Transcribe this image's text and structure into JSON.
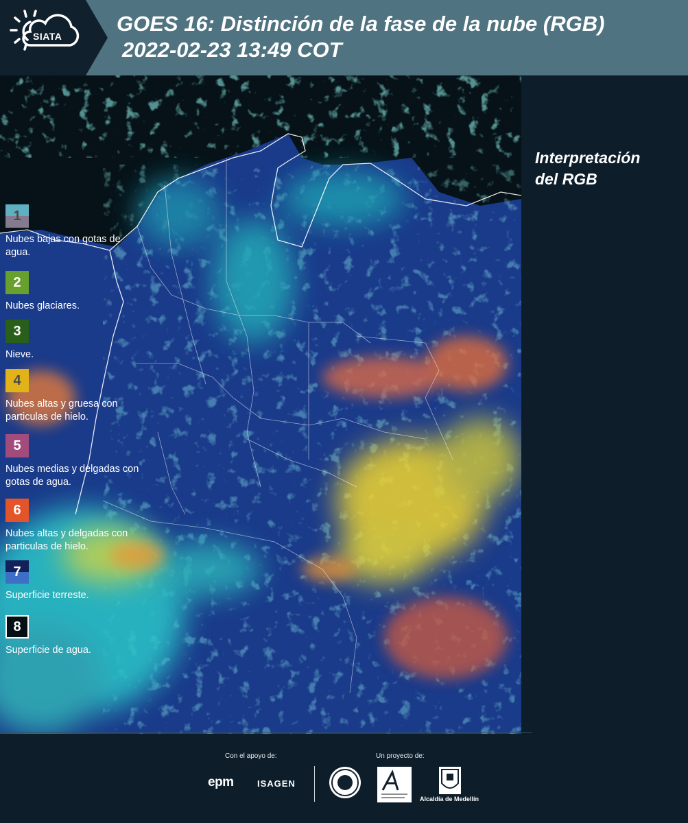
{
  "header": {
    "logo_text": "SIATA",
    "title_line1": "GOES 16: Distinción de la fase de la nube (RGB)",
    "title_line2": "2022-02-23 13:49 COT"
  },
  "legend": {
    "title_line1": "Interpretación",
    "title_line2": "del RGB",
    "items": [
      {
        "number": "1",
        "label": "Nubes bajas con gotas de agua.",
        "color_top": "#5fb0c0",
        "color_bottom": "#857a8e",
        "num_color": "#4a4a4a"
      },
      {
        "number": "2",
        "label": "Nubes glaciares.",
        "color_top": "#67a02c",
        "color_bottom": "#67a02c",
        "num_color": "#ffffff"
      },
      {
        "number": "3",
        "label": "Nieve.",
        "color_top": "#2a5f1b",
        "color_bottom": "#2a5f1b",
        "num_color": "#ffffff"
      },
      {
        "number": "4",
        "label": "Nubes altas y gruesa con particulas de hielo.",
        "color_top": "#e2b319",
        "color_bottom": "#e2b319",
        "num_color": "#4a4a4a"
      },
      {
        "number": "5",
        "label": "Nubes medias y delgadas con gotas de agua.",
        "color_top": "#a24c7d",
        "color_bottom": "#a24c7d",
        "num_color": "#ffffff"
      },
      {
        "number": "6",
        "label": "Nubes altas y delgadas con particulas de hielo.",
        "color_top": "#e4542b",
        "color_bottom": "#e4542b",
        "num_color": "#ffffff"
      },
      {
        "number": "7",
        "label": "Superficie terreste.",
        "color_top": "#14205a",
        "color_bottom": "#3d6fc7",
        "num_color": "#ffffff"
      },
      {
        "number": "8",
        "label": "Superficie de agua.",
        "color_top": "#061014",
        "color_bottom": "#061014",
        "num_color": "#ffffff"
      }
    ]
  },
  "footer": {
    "support_label": "Con el apoyo de:",
    "project_label": "Un proyecto de:",
    "sponsor1": "epm",
    "sponsor2": "ISAGEN",
    "partner_alcaldia": "Alcaldía de Medellín"
  }
}
